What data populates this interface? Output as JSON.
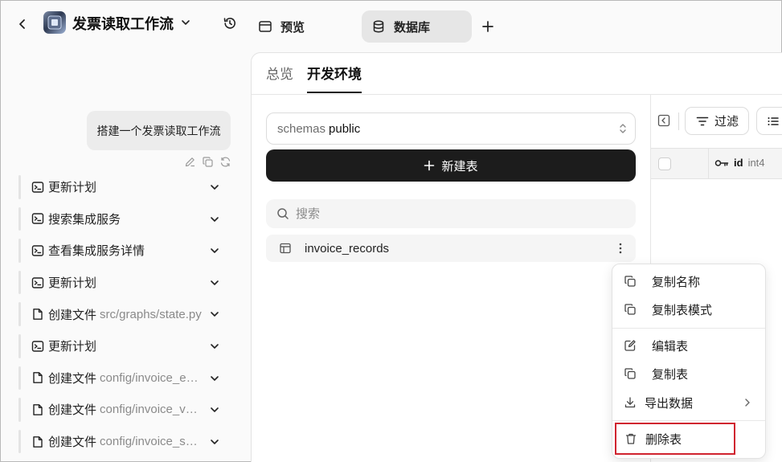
{
  "header": {
    "app_title": "发票读取工作流",
    "tabs": [
      {
        "label": "预览",
        "icon": "window-icon"
      },
      {
        "label": "数据库",
        "icon": "database-icon",
        "active": true
      }
    ]
  },
  "chat": {
    "user_message": "搭建一个发票读取工作流",
    "steps": [
      {
        "icon": "terminal-icon",
        "label": "更新计划",
        "path": ""
      },
      {
        "icon": "terminal-icon",
        "label": "搜索集成服务",
        "path": ""
      },
      {
        "icon": "terminal-icon",
        "label": "查看集成服务详情",
        "path": ""
      },
      {
        "icon": "terminal-icon",
        "label": "更新计划",
        "path": ""
      },
      {
        "icon": "file-icon",
        "label": "创建文件",
        "path": "src/graphs/state.py"
      },
      {
        "icon": "terminal-icon",
        "label": "更新计划",
        "path": ""
      },
      {
        "icon": "file-icon",
        "label": "创建文件",
        "path": "config/invoice_extract.json"
      },
      {
        "icon": "file-icon",
        "label": "创建文件",
        "path": "config/invoice_validate.json"
      },
      {
        "icon": "file-icon",
        "label": "创建文件",
        "path": "config/invoice_summary.json"
      }
    ]
  },
  "database": {
    "subtabs": [
      "总览",
      "开发环境"
    ],
    "active_subtab": 1,
    "schema_key": "schemas",
    "schema_value": "public",
    "new_table_label": "新建表",
    "search_placeholder": "搜索",
    "tables": [
      "invoice_records"
    ]
  },
  "grid": {
    "filter_label": "过滤",
    "columns": [
      {
        "name": "id",
        "type": "int4",
        "primary_key": true
      }
    ]
  },
  "context_menu": {
    "items": [
      {
        "label": "复制名称",
        "icon": "copy-icon"
      },
      {
        "label": "复制表模式",
        "icon": "copy-icon"
      },
      {
        "label": "编辑表",
        "icon": "edit-icon"
      },
      {
        "label": "复制表",
        "icon": "copy-icon"
      },
      {
        "label": "导出数据",
        "icon": "download-icon",
        "has_submenu": true
      },
      {
        "label": "删除表",
        "icon": "trash-icon",
        "highlighted": true
      }
    ]
  },
  "colors": {
    "highlight_border": "#d0242f",
    "primary_button": "#1c1c1c"
  }
}
